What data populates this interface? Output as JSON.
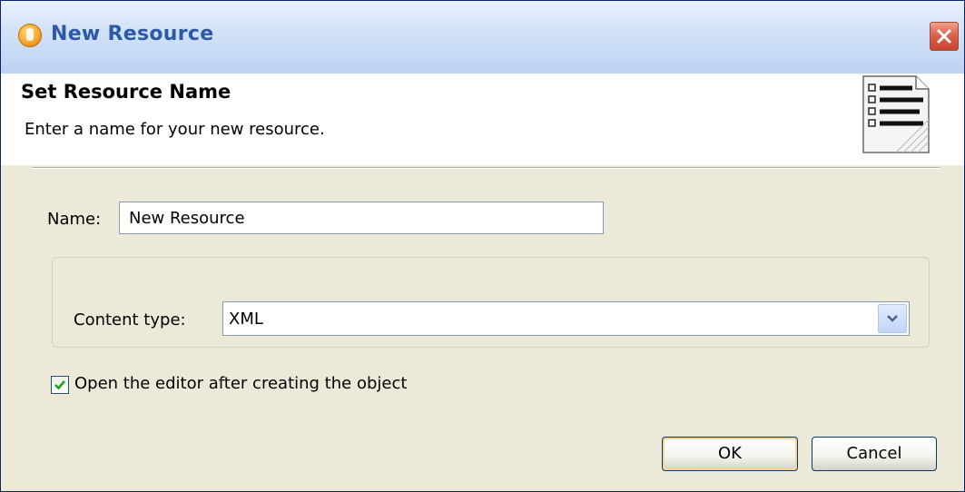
{
  "window": {
    "title": "New Resource"
  },
  "header": {
    "title": "Set Resource Name",
    "description": "Enter a name for your new resource."
  },
  "form": {
    "name_label": "Name:",
    "name_value": "New Resource",
    "content_type_label": "Content type:",
    "content_type_value": "XML",
    "open_editor_label": "Open the editor after creating the object",
    "open_editor_checked": true
  },
  "buttons": {
    "ok": "OK",
    "cancel": "Cancel"
  },
  "icons": {
    "app": "app-icon",
    "close": "close-icon",
    "wizard_banner": "document-list-icon",
    "dropdown": "chevron-down-icon",
    "checkbox_check": "checkmark-icon"
  },
  "colors": {
    "title_text": "#2d5aa8",
    "dialog_background": "#ece9d8",
    "close_button": "#d9604a",
    "checkmark": "#21a121"
  }
}
